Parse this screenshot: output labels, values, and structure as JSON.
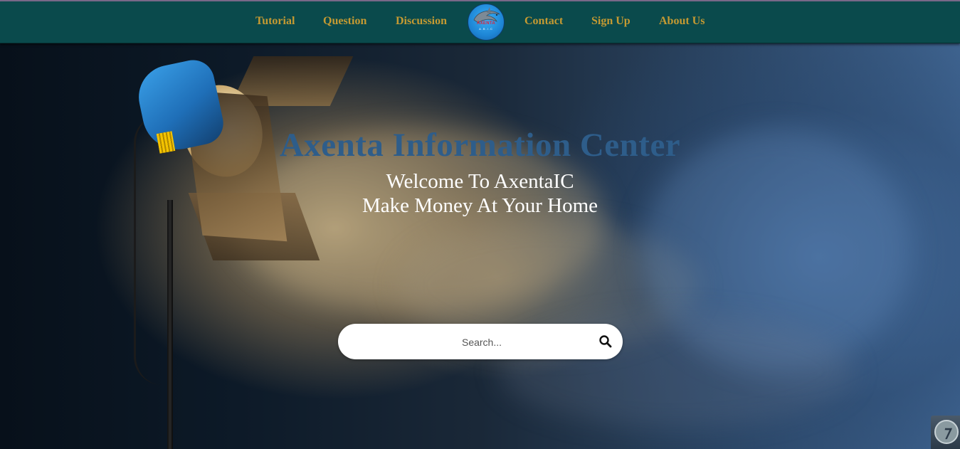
{
  "nav": {
    "links": [
      {
        "label": "Tutorial"
      },
      {
        "label": "Question"
      },
      {
        "label": "Discussion"
      },
      {
        "label": "Contact"
      },
      {
        "label": "Sign Up"
      },
      {
        "label": "About Us"
      }
    ],
    "logo": {
      "text": "AXENTA",
      "subtext": "A.B.I.C",
      "icon": "dolphin-logo"
    }
  },
  "hero": {
    "title": "Axenta Information Center",
    "welcome": "Welcome To AxentaIC",
    "tagline": "Make Money At Your Home",
    "background_image": "studio-light-smoke"
  },
  "search": {
    "placeholder": "Search...",
    "value": "",
    "icon": "search-icon"
  },
  "corner_badge": {
    "glyph": "⁊",
    "icon": "assistant-badge-icon"
  },
  "colors": {
    "nav_bg": "#0a4a4c",
    "nav_link": "#c59a32",
    "title": "#2e5d8a",
    "subtitle": "#ffffff"
  }
}
